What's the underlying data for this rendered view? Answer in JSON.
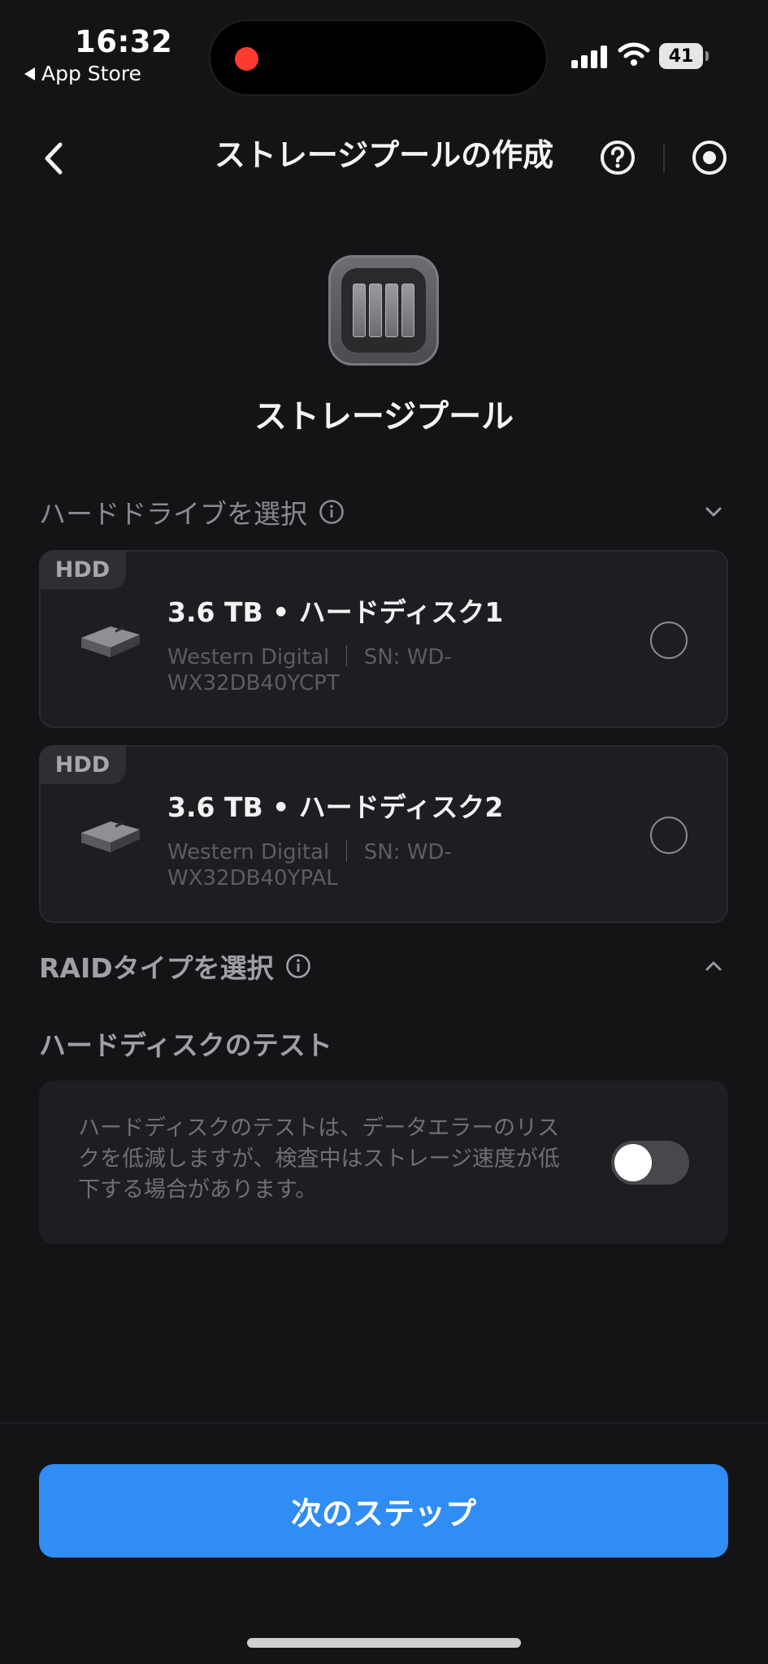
{
  "status_bar": {
    "time": "16:32",
    "back_app": "App Store",
    "battery": "41"
  },
  "nav": {
    "title": "ストレージプールの作成"
  },
  "hero": {
    "label": "ストレージプール"
  },
  "sections": {
    "drives": "ハードドライブを選択",
    "raid": "RAIDタイプを選択",
    "test": "ハードディスクのテスト"
  },
  "disks": [
    {
      "tag": "HDD",
      "title": "3.6 TB • ハードディスク1",
      "vendor": "Western Digital ｜ SN: WD-",
      "serial": "WX32DB40YCPT",
      "selected": false
    },
    {
      "tag": "HDD",
      "title": "3.6 TB • ハードディスク2",
      "vendor": "Western Digital ｜ SN: WD-",
      "serial": "WX32DB40YPAL",
      "selected": false
    }
  ],
  "test_card": {
    "description": "ハードディスクのテストは、データエラーのリスクを低減しますが、検査中はストレージ速度が低下する場合があります。",
    "toggle_on": false
  },
  "footer": {
    "next_label": "次のステップ"
  },
  "colors": {
    "background": "#141316",
    "card": "#1e1d21",
    "accent": "#2f8df5",
    "recording": "#ff3b30"
  }
}
